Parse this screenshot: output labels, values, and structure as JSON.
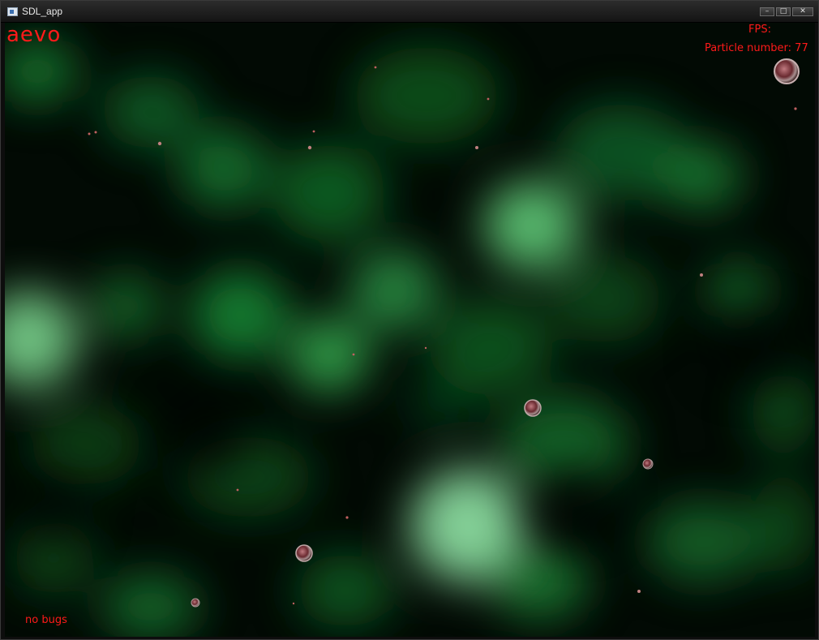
{
  "window": {
    "title": "SDL_app",
    "controls": {
      "minimize": "–",
      "maximize": "□",
      "close": "✕"
    }
  },
  "hud": {
    "logo": "aevo",
    "fps": "FPS:",
    "particle_count": "Particle number: 77",
    "status": "no bugs"
  },
  "colors": {
    "hud_text": "#ff1a1a",
    "background_base": "#020a04",
    "glow": "#22c84a"
  }
}
